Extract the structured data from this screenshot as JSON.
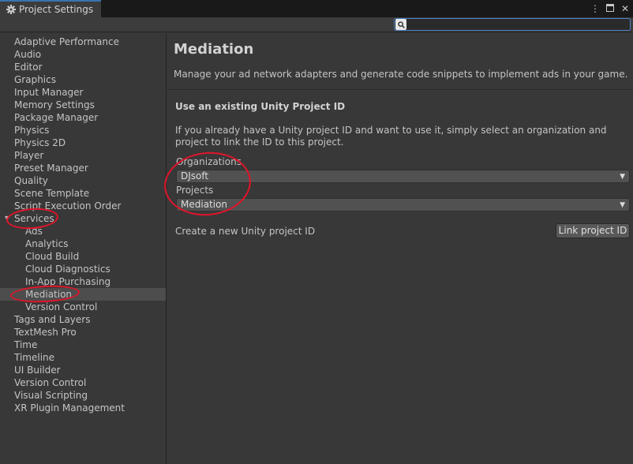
{
  "window": {
    "title": "Project Settings",
    "icons": {
      "settings": "gear-icon",
      "menu": "kebab-menu-icon",
      "maximize": "maximize-icon",
      "close": "close-icon"
    }
  },
  "search": {
    "value": "",
    "placeholder": "",
    "icon": "search-icon"
  },
  "sidebar": {
    "items": [
      {
        "label": "Adaptive Performance"
      },
      {
        "label": "Audio"
      },
      {
        "label": "Editor"
      },
      {
        "label": "Graphics"
      },
      {
        "label": "Input Manager"
      },
      {
        "label": "Memory Settings"
      },
      {
        "label": "Package Manager"
      },
      {
        "label": "Physics"
      },
      {
        "label": "Physics 2D"
      },
      {
        "label": "Player"
      },
      {
        "label": "Preset Manager"
      },
      {
        "label": "Quality"
      },
      {
        "label": "Scene Template"
      },
      {
        "label": "Script Execution Order"
      },
      {
        "label": "Services",
        "expanded": true
      },
      {
        "label": "Ads",
        "child": true
      },
      {
        "label": "Analytics",
        "child": true
      },
      {
        "label": "Cloud Build",
        "child": true
      },
      {
        "label": "Cloud Diagnostics",
        "child": true
      },
      {
        "label": "In-App Purchasing",
        "child": true
      },
      {
        "label": "Mediation",
        "child": true,
        "selected": true
      },
      {
        "label": "Version Control",
        "child": true
      },
      {
        "label": "Tags and Layers"
      },
      {
        "label": "TextMesh Pro"
      },
      {
        "label": "Time"
      },
      {
        "label": "Timeline"
      },
      {
        "label": "UI Builder"
      },
      {
        "label": "Version Control"
      },
      {
        "label": "Visual Scripting"
      },
      {
        "label": "XR Plugin Management"
      }
    ]
  },
  "main": {
    "title": "Mediation",
    "description": "Manage your ad network adapters and generate code snippets to implement ads in your game.",
    "section_title": "Use an existing Unity Project ID",
    "section_description": "If you already have a Unity project ID and want to use it, simply select an organization and project to link the ID to this project.",
    "organizations_label": "Organizations",
    "organizations_value": "DJsoft",
    "projects_label": "Projects",
    "projects_value": "Mediation",
    "create_label": "Create a new Unity project ID",
    "link_button": "Link project ID"
  },
  "colors": {
    "background": "#383838",
    "tabbar": "#191919",
    "accent": "#4a82c4",
    "annotation": "#e0152a"
  }
}
